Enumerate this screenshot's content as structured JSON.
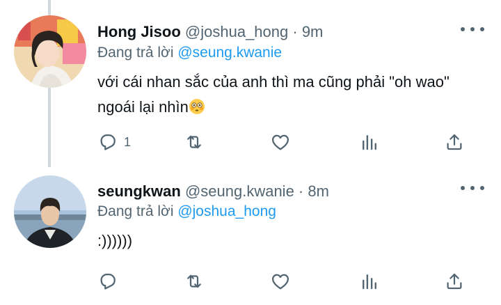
{
  "tweets": [
    {
      "name": "Hong Jisoo",
      "handle": "@joshua_hong",
      "separator": " · ",
      "time": "9m",
      "replying_prefix": "Đang trả lời ",
      "replying_to": "@seung.kwanie",
      "text_line1": "với cái nhan sắc của anh thì ma cũng phải \"oh wao\"",
      "text_line2": "ngoái lại nhìn",
      "reply_count": "1"
    },
    {
      "name": "seungkwan",
      "handle": "@seung.kwanie",
      "separator": " · ",
      "time": "8m",
      "replying_prefix": "Đang trả lời ",
      "replying_to": "@joshua_hong",
      "text_line1": ":))))))",
      "reply_count": ""
    }
  ],
  "icons": {
    "reply": "reply-icon",
    "retweet": "retweet-icon",
    "like": "like-icon",
    "views": "views-icon",
    "share": "share-icon",
    "more": "more-icon",
    "emoji": "flushed-face-emoji"
  },
  "colors": {
    "text": "#0f1419",
    "secondary": "#536471",
    "accent": "#1d9bf0",
    "thread_line": "#cfd9de"
  }
}
